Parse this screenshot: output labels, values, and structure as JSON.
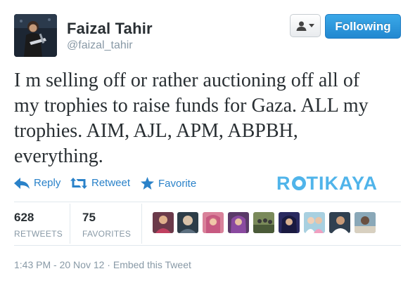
{
  "user": {
    "name": "Faizal Tahir",
    "handle": "@faizal_tahir"
  },
  "header": {
    "follow_label": "Following",
    "user_menu_icon": "user-dropdown-icon"
  },
  "tweet": {
    "lines": [
      "I m selling off or rather auctioning off all of",
      "my trophies to raise funds for Gaza. ALL my",
      "trophies. AIM, AJL, APM, ABPBH,",
      "everything."
    ]
  },
  "actions": {
    "reply_label": "Reply",
    "retweet_label": "Retweet",
    "favorite_label": "Favorite"
  },
  "watermark": {
    "text_before": "R",
    "text_after": "TIKAYA"
  },
  "stats": {
    "retweets_count": "628",
    "retweets_label": "RETWEETS",
    "favorites_count": "75",
    "favorites_label": "FAVORITES"
  },
  "favoriters_avatars": 10,
  "footer": {
    "timestamp": "1:43 PM - 20 Nov 12",
    "separator": "·",
    "embed_label": "Embed this Tweet"
  },
  "colors": {
    "link_blue": "#2a82c9",
    "follow_button": "#2a93dd",
    "muted_gray": "#8899a6",
    "watermark": "#50b4ea"
  }
}
